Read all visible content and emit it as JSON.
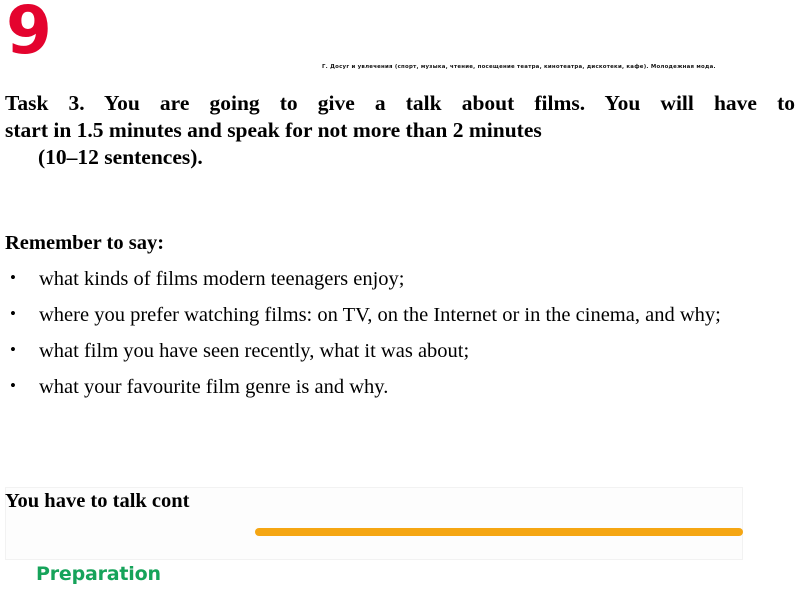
{
  "slide": {
    "number": "9",
    "number_color": "#e4032e",
    "topic_caption": "Г. Досуг и увлечения (спорт, музыка, чтение, посещение театра, кинотеатра, дискотеки, кафе). Молодежная мода.",
    "task": {
      "line1": "Task 3. You are going to give a talk about films. You will have to",
      "line2": "start in 1.5 minutes and speak for not more than 2 minutes",
      "line3": "(10–12 sentences)."
    },
    "remember_heading": "Remember to say:",
    "bullets": [
      {
        "text": "what kinds of films modern teenagers enjoy;",
        "marker": "•"
      },
      {
        "text": "where you prefer watching films: on TV, on the Internet or in the cinema, and why;",
        "marker": "•"
      },
      {
        "text": "what film you have seen recently, what  it was about;",
        "marker": "•"
      },
      {
        "text": "what your favourite film genre is and why.",
        "marker": "•"
      }
    ],
    "footer": {
      "talk_cont": "You have to talk cont",
      "preparation_label": "Preparation",
      "preparation_color": "#16a35a",
      "divider_color": "#f5a613"
    }
  }
}
